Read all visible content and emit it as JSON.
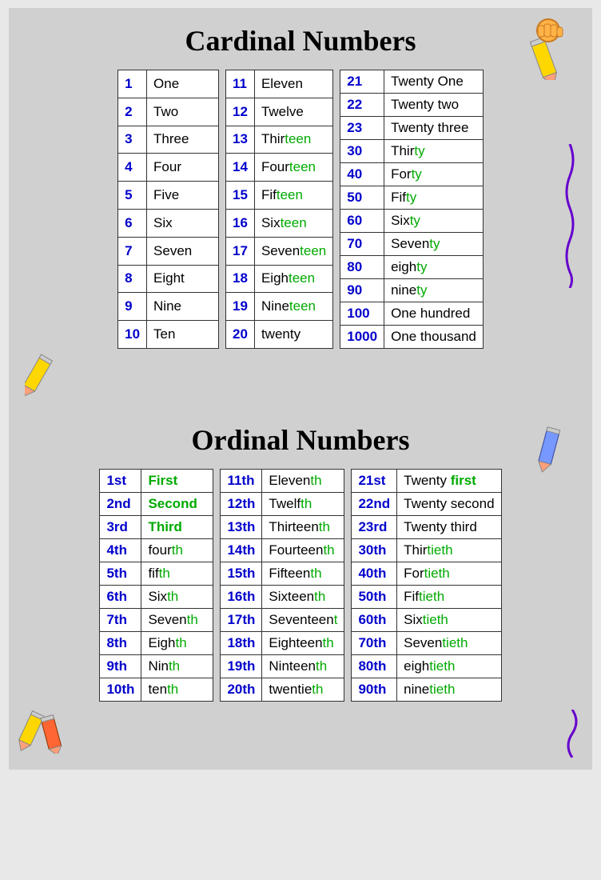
{
  "cardinal": {
    "title": "Cardinal Numbers",
    "col1": [
      {
        "num": "1",
        "word": "One"
      },
      {
        "num": "2",
        "word": "Two"
      },
      {
        "num": "3",
        "word": "Three"
      },
      {
        "num": "4",
        "word": "Four"
      },
      {
        "num": "5",
        "word": "Five"
      },
      {
        "num": "6",
        "word": "Six"
      },
      {
        "num": "7",
        "word": "Seven"
      },
      {
        "num": "8",
        "word": "Eight"
      },
      {
        "num": "9",
        "word": "Nine"
      },
      {
        "num": "10",
        "word": "Ten"
      }
    ],
    "col2": [
      {
        "num": "11",
        "word": "Eleven",
        "style": "black"
      },
      {
        "num": "12",
        "word": "Twelve",
        "style": "black"
      },
      {
        "num": "13",
        "word1": "Thir",
        "word2": "teen",
        "style": "split"
      },
      {
        "num": "14",
        "word1": "Four",
        "word2": "teen",
        "style": "split"
      },
      {
        "num": "15",
        "word1": "Fif",
        "word2": "teen",
        "style": "split"
      },
      {
        "num": "16",
        "word1": "Six",
        "word2": "teen",
        "style": "split"
      },
      {
        "num": "17",
        "word1": "Seven",
        "word2": "teen",
        "style": "split"
      },
      {
        "num": "18",
        "word1": "Eigh",
        "word2": "teen",
        "style": "split"
      },
      {
        "num": "19",
        "word1": "Nine",
        "word2": "teen",
        "style": "split"
      },
      {
        "num": "20",
        "word": "twenty",
        "style": "black"
      }
    ],
    "col3": [
      {
        "num": "21",
        "word": "Twenty One",
        "style": "black"
      },
      {
        "num": "22",
        "word": "Twenty two",
        "style": "black"
      },
      {
        "num": "23",
        "word": "Twenty three",
        "style": "black"
      },
      {
        "num": "30",
        "word1": "Thir",
        "word2": "ty",
        "style": "split"
      },
      {
        "num": "40",
        "word1": "For",
        "word2": "ty",
        "style": "split"
      },
      {
        "num": "50",
        "word1": "Fif",
        "word2": "ty",
        "style": "split"
      },
      {
        "num": "60",
        "word1": "Six",
        "word2": "ty",
        "style": "split"
      },
      {
        "num": "70",
        "word1": "Seven",
        "word2": "ty",
        "style": "split"
      },
      {
        "num": "80",
        "word1": "eigh",
        "word2": "ty",
        "style": "split"
      },
      {
        "num": "90",
        "word1": "nine",
        "word2": "ty",
        "style": "split"
      },
      {
        "num": "100",
        "word": "One hundred",
        "style": "black"
      },
      {
        "num": "1000",
        "word": "One thousand",
        "style": "black"
      }
    ]
  },
  "ordinal": {
    "title": "Ordinal Numbers",
    "col1": [
      {
        "num": "1st",
        "word": "First",
        "style": "green"
      },
      {
        "num": "2nd",
        "word": "Second",
        "style": "green"
      },
      {
        "num": "3rd",
        "word": "Third",
        "style": "green"
      },
      {
        "num": "4th",
        "word1": "four",
        "word2": "th",
        "style": "split"
      },
      {
        "num": "5th",
        "word1": "fif",
        "word2": "th",
        "style": "split"
      },
      {
        "num": "6th",
        "word1": "Six",
        "word2": "th",
        "style": "split"
      },
      {
        "num": "7th",
        "word1": "Seven",
        "word2": "th",
        "style": "split"
      },
      {
        "num": "8th",
        "word1": "Eigh",
        "word2": "th",
        "style": "split"
      },
      {
        "num": "9th",
        "word1": "Nin",
        "word2": "th",
        "style": "split"
      },
      {
        "num": "10th",
        "word1": "ten",
        "word2": "th",
        "style": "split"
      }
    ],
    "col2": [
      {
        "num": "11th",
        "word1": "Eleven",
        "word2": "th",
        "style": "split"
      },
      {
        "num": "12th",
        "word1": "Twelf",
        "word2": "th",
        "style": "split"
      },
      {
        "num": "13th",
        "word1": "Thirteen",
        "word2": "th",
        "style": "split"
      },
      {
        "num": "14th",
        "word1": "Fourteen",
        "word2": "th",
        "style": "split"
      },
      {
        "num": "15th",
        "word1": "Fifteen",
        "word2": "th",
        "style": "split"
      },
      {
        "num": "16th",
        "word1": "Sixteen",
        "word2": "th",
        "style": "split"
      },
      {
        "num": "17th",
        "word1": "Seventeen",
        "word2": "t",
        "style": "split"
      },
      {
        "num": "18th",
        "word1": "Eighteen",
        "word2": "th",
        "style": "split"
      },
      {
        "num": "19th",
        "word1": "Ninteen",
        "word2": "th",
        "style": "split"
      },
      {
        "num": "20th",
        "word1": "twentie",
        "word2": "th",
        "style": "split"
      }
    ],
    "col3": [
      {
        "num": "21st",
        "word1": "Twenty ",
        "word2": "first",
        "style": "split-green"
      },
      {
        "num": "22nd",
        "word": "Twenty second",
        "style": "black"
      },
      {
        "num": "23rd",
        "word": "Twenty third",
        "style": "black"
      },
      {
        "num": "30th",
        "word1": "Thir",
        "word2": "tieth",
        "style": "split"
      },
      {
        "num": "40th",
        "word1": "For",
        "word2": "tieth",
        "style": "split"
      },
      {
        "num": "50th",
        "word1": "Fif",
        "word2": "tieth",
        "style": "split"
      },
      {
        "num": "60th",
        "word1": "Six",
        "word2": "tieth",
        "style": "split"
      },
      {
        "num": "70th",
        "word1": "Seven",
        "word2": "tieth",
        "style": "split"
      },
      {
        "num": "80th",
        "word1": "eigh",
        "word2": "tieth",
        "style": "split"
      },
      {
        "num": "90th",
        "word1": "nine",
        "word2": "tieth",
        "style": "split"
      }
    ]
  }
}
